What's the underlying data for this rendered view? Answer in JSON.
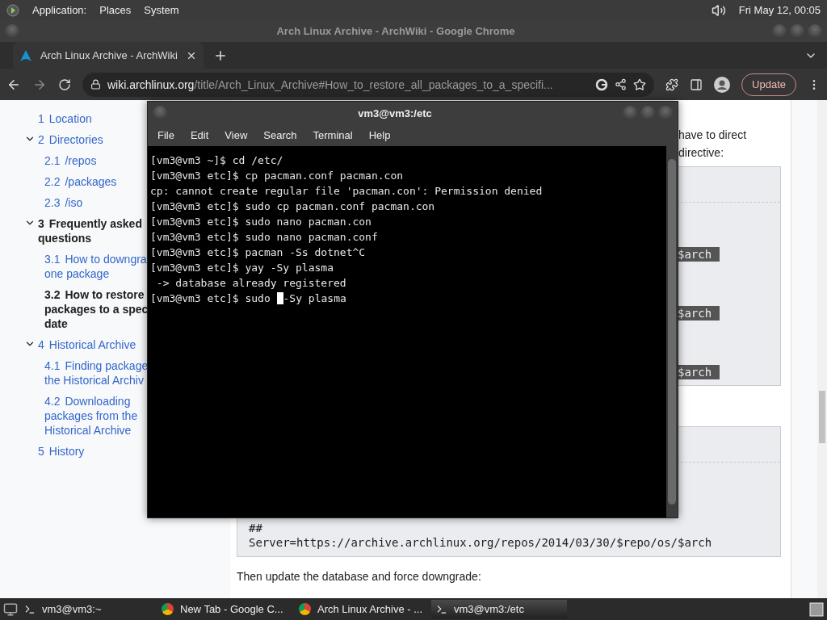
{
  "top_panel": {
    "menus": [
      "Application:",
      "Places",
      "System"
    ],
    "clock": "Fri May 12, 00:05"
  },
  "browser": {
    "title": "Arch Linux Archive - ArchWiki - Google Chrome",
    "tabs": [
      {
        "label": "Arch Linux Archive - ArchWiki",
        "selected": true
      }
    ],
    "url": {
      "host": "wiki.archlinux.org",
      "path": "/title/Arch_Linux_Archive#How_to_restore_all_packages_to_a_specifi..."
    },
    "update_button": "Update",
    "toc": [
      {
        "number": "1",
        "lines": [
          "Location"
        ]
      },
      {
        "number": "2",
        "lines": [
          "Directories"
        ],
        "expanded": true,
        "children": [
          {
            "number": "2.1",
            "lines": [
              "/repos"
            ],
            "selected": false
          },
          {
            "number": "2.2",
            "lines": [
              "/packages"
            ],
            "selected": false
          },
          {
            "number": "2.3",
            "lines": [
              "/iso"
            ],
            "selected": false
          }
        ]
      },
      {
        "number": "3",
        "lines": [
          "Frequently asked",
          "questions"
        ],
        "expanded": true,
        "children": [
          {
            "number": "3.1",
            "lines": [
              "How to downgra",
              "one package"
            ],
            "selected": false
          },
          {
            "number": "3.2",
            "lines": [
              "How to restore",
              "packages to a spec",
              "date"
            ],
            "selected": true
          }
        ]
      },
      {
        "number": "4",
        "lines": [
          "Historical Archive"
        ],
        "expanded": true,
        "children": [
          {
            "number": "4.1",
            "lines": [
              "Finding package",
              "the Historical Archiv"
            ],
            "selected": false
          },
          {
            "number": "4.2",
            "lines": [
              "Downloading",
              "packages from the",
              "Historical Archive"
            ],
            "selected": false
          }
        ]
      },
      {
        "number": "5",
        "lines": [
          "History"
        ]
      }
    ],
    "content": {
      "intro_lines": [
        "have to direct",
        "directive:"
      ],
      "code_block_1": {
        "highlights": [
          "$arch",
          "$arch",
          "$arch"
        ]
      },
      "code_block_2": {
        "lines": [
          "##",
          "Server=https://archive.archlinux.org/repos/2014/03/30/$repo/os/$arch"
        ]
      },
      "after_text": "Then update the database and force downgrade:"
    }
  },
  "terminal": {
    "title": "vm3@vm3:/etc",
    "menus": [
      "File",
      "Edit",
      "View",
      "Search",
      "Terminal",
      "Help"
    ],
    "lines": [
      "[vm3@vm3 ~]$ cd /etc/",
      "[vm3@vm3 etc]$ cp pacman.conf pacman.con",
      "cp: cannot create regular file 'pacman.con': Permission denied",
      "[vm3@vm3 etc]$ sudo cp pacman.conf pacman.con",
      "[vm3@vm3 etc]$ sudo nano pacman.con",
      "[vm3@vm3 etc]$ sudo nano pacman.conf",
      "[vm3@vm3 etc]$ pacman -Ss dotnet^C",
      "[vm3@vm3 etc]$ yay -Sy plasma",
      " -> database already registered"
    ],
    "input": {
      "before": "[vm3@vm3 etc]$ sudo ",
      "after": "-Sy plasma"
    }
  },
  "taskbar": [
    {
      "kind": "terminal",
      "label": "vm3@vm3:~",
      "selected": false
    },
    {
      "kind": "chrome",
      "label": "New Tab - Google C...",
      "selected": false
    },
    {
      "kind": "chrome",
      "label": "Arch Linux Archive - ...",
      "selected": false
    },
    {
      "kind": "terminal",
      "label": "vm3@vm3:/etc",
      "selected": true
    }
  ]
}
